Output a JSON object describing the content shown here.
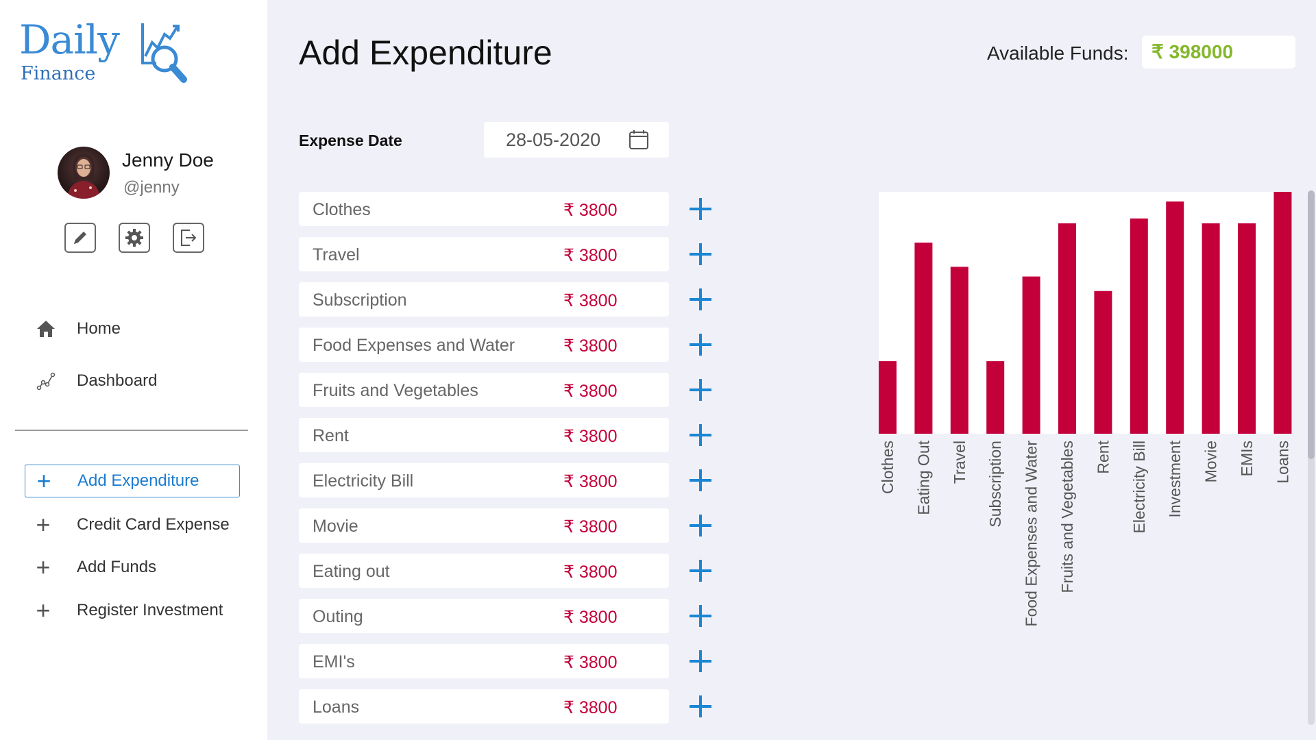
{
  "app": {
    "logo_word": "Daily",
    "logo_sub": "Finance",
    "brand_color": "#3a8ad4"
  },
  "profile": {
    "name": "Jenny Doe",
    "handle": "@jenny"
  },
  "profile_actions": [
    {
      "icon": "pencil-icon"
    },
    {
      "icon": "gear-icon"
    },
    {
      "icon": "logout-icon"
    }
  ],
  "nav": [
    {
      "label": "Home",
      "icon": "home-icon"
    },
    {
      "label": "Dashboard",
      "icon": "chart-line-icon"
    }
  ],
  "menu": [
    {
      "label": "Add Expenditure",
      "icon": "plus-icon",
      "active": true
    },
    {
      "label": "Credit Card Expense",
      "icon": "plus-icon",
      "active": false
    },
    {
      "label": "Add Funds",
      "icon": "plus-icon",
      "active": false
    },
    {
      "label": "Register Investment",
      "icon": "plus-icon",
      "active": false
    }
  ],
  "page": {
    "title": "Add Expenditure",
    "funds_label": "Available Funds:",
    "funds_value": "₹ 398000"
  },
  "expense_date": {
    "label": "Expense Date",
    "value": "28-05-2020"
  },
  "expenses": [
    {
      "name": "Clothes",
      "amount": "₹ 3800"
    },
    {
      "name": "Travel",
      "amount": "₹ 3800"
    },
    {
      "name": "Subscription",
      "amount": "₹ 3800"
    },
    {
      "name": "Food Expenses and Water",
      "amount": "₹ 3800"
    },
    {
      "name": "Fruits and Vegetables",
      "amount": "₹ 3800"
    },
    {
      "name": "Rent",
      "amount": "₹ 3800"
    },
    {
      "name": "Electricity Bill",
      "amount": "₹ 3800"
    },
    {
      "name": "Movie",
      "amount": "₹ 3800"
    },
    {
      "name": "Eating out",
      "amount": "₹ 3800"
    },
    {
      "name": "Outing",
      "amount": "₹ 3800"
    },
    {
      "name": "EMI's",
      "amount": "₹ 3800"
    },
    {
      "name": "Loans",
      "amount": "₹ 3800"
    }
  ],
  "colors": {
    "amount": "#c4003a",
    "funds": "#84b82c",
    "add": "#1a86d4",
    "bar": "#c4003a"
  },
  "chart_data": {
    "type": "bar",
    "categories": [
      "Clothes",
      "Eating Out",
      "Travel",
      "Subscription",
      "Food Expenses and Water",
      "Fruits and Vegetables",
      "Rent",
      "Electricity Bill",
      "Investment",
      "Movie",
      "EMIs",
      "Loans"
    ],
    "values": [
      30,
      79,
      69,
      30,
      65,
      87,
      59,
      89,
      96,
      87,
      87,
      100
    ],
    "ylim": [
      0,
      100
    ],
    "grid": false,
    "legend": "none"
  }
}
